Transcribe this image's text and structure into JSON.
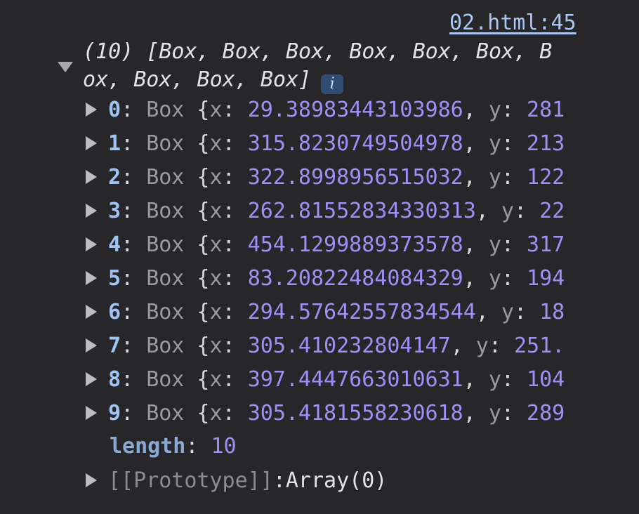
{
  "console": {
    "source_link": "02.html:45",
    "array_summary": {
      "line1": "(10) [Box, Box, Box, Box, Box, Box, B",
      "line2": "ox, Box, Box, Box]",
      "info_badge": "i"
    },
    "entries": [
      {
        "index": "0",
        "class_name": "Box",
        "x_key": "x",
        "x_value": "29.38983443103986",
        "y_key": "y",
        "y_value_visible": "281"
      },
      {
        "index": "1",
        "class_name": "Box",
        "x_key": "x",
        "x_value": "315.8230749504978",
        "y_key": "y",
        "y_value_visible": "213"
      },
      {
        "index": "2",
        "class_name": "Box",
        "x_key": "x",
        "x_value": "322.8998956515032",
        "y_key": "y",
        "y_value_visible": "122"
      },
      {
        "index": "3",
        "class_name": "Box",
        "x_key": "x",
        "x_value": "262.81552834330313",
        "y_key": "y",
        "y_value_visible": "22"
      },
      {
        "index": "4",
        "class_name": "Box",
        "x_key": "x",
        "x_value": "454.1299889373578",
        "y_key": "y",
        "y_value_visible": "317"
      },
      {
        "index": "5",
        "class_name": "Box",
        "x_key": "x",
        "x_value": "83.20822484084329",
        "y_key": "y",
        "y_value_visible": "194"
      },
      {
        "index": "6",
        "class_name": "Box",
        "x_key": "x",
        "x_value": "294.57642557834544",
        "y_key": "y",
        "y_value_visible": "18"
      },
      {
        "index": "7",
        "class_name": "Box",
        "x_key": "x",
        "x_value": "305.410232804147",
        "y_key": "y",
        "y_value_visible": "251."
      },
      {
        "index": "8",
        "class_name": "Box",
        "x_key": "x",
        "x_value": "397.4447663010631",
        "y_key": "y",
        "y_value_visible": "104"
      },
      {
        "index": "9",
        "class_name": "Box",
        "x_key": "x",
        "x_value": "305.4181558230618",
        "y_key": "y",
        "y_value_visible": "289"
      }
    ],
    "length": {
      "key": "length",
      "value": "10"
    },
    "prototype": {
      "key": "[[Prototype]]",
      "value": "Array(0)"
    }
  },
  "colors": {
    "background": "#272729",
    "index": "#9fc4f4",
    "number": "#9f8ff6",
    "muted": "#9a9a9e",
    "link": "#a9c7f4"
  }
}
